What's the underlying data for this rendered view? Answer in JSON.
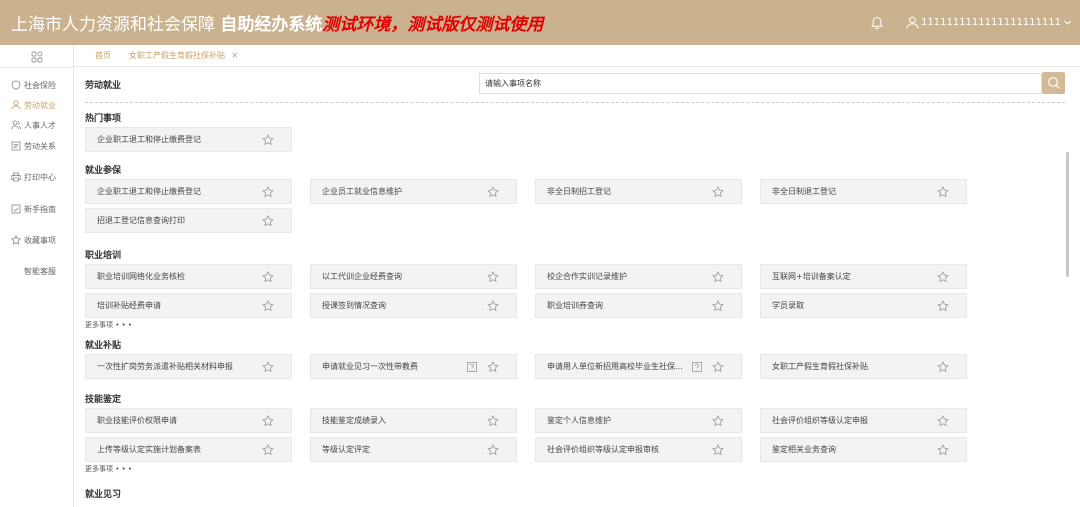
{
  "header": {
    "title_prefix": "上海市人力资源和社会保障",
    "title_bold": "自助经办系统",
    "title_warning": "测试环境，测试版仅测试使用",
    "username": "1111111111111111111111"
  },
  "sidebar": {
    "items": [
      {
        "label": "社会保险",
        "icon": "shield-icon"
      },
      {
        "label": "劳动就业",
        "icon": "person-icon"
      },
      {
        "label": "人事人才",
        "icon": "people-icon"
      },
      {
        "label": "劳动关系",
        "icon": "document-icon"
      },
      {
        "label": "打印中心",
        "icon": "printer-icon"
      },
      {
        "label": "新手指南",
        "icon": "guide-icon"
      },
      {
        "label": "收藏事项",
        "icon": "star-icon"
      },
      {
        "label": "智能客服",
        "icon": ""
      }
    ]
  },
  "tabs": [
    {
      "label": "首页"
    },
    {
      "label": "女职工产假生育假社保补贴"
    }
  ],
  "content": {
    "page_title": "劳动就业",
    "search_placeholder": "请输入事项名称",
    "more_label": "更多事项 • • •",
    "sections": [
      {
        "title": "热门事项",
        "items": [
          "企业职工退工和停止缴费登记"
        ]
      },
      {
        "title": "就业参保",
        "items": [
          "企业职工退工和停止缴费登记",
          "企业员工就业信息维护",
          "非全日制招工登记",
          "非全日制退工登记",
          "招退工登记信息查询打印"
        ]
      },
      {
        "title": "职业培训",
        "items": [
          "职业培训网络化业务核检",
          "以工代训企业经费查询",
          "校企合作实训记录维护",
          "互联网+培训备案认定",
          "培训补贴经费申请",
          "授课签到情况查询",
          "职业培训券查询",
          "学员录取"
        ]
      },
      {
        "title": "就业补贴",
        "items": [
          "一次性扩岗劳务派遣补贴相关材料申报",
          "申请就业见习一次性带教费",
          "申请用人单位新招用高校毕业生社保...",
          "女职工产假生育假社保补贴"
        ]
      },
      {
        "title": "技能鉴定",
        "items": [
          "职业技能评价权限申请",
          "技能鉴定成绩录入",
          "鉴定个人信息维护",
          "社会评价组织等级认定申报",
          "上传等级认定实施计划备案表",
          "等级认定评定",
          "社会评价组织等级认定申报审核",
          "鉴定相关业务查询"
        ]
      },
      {
        "title": "就业见习",
        "items": []
      }
    ]
  },
  "colors": {
    "header_bg": "#cbb28f",
    "accent": "#c9a063",
    "warning": "#e40000"
  }
}
